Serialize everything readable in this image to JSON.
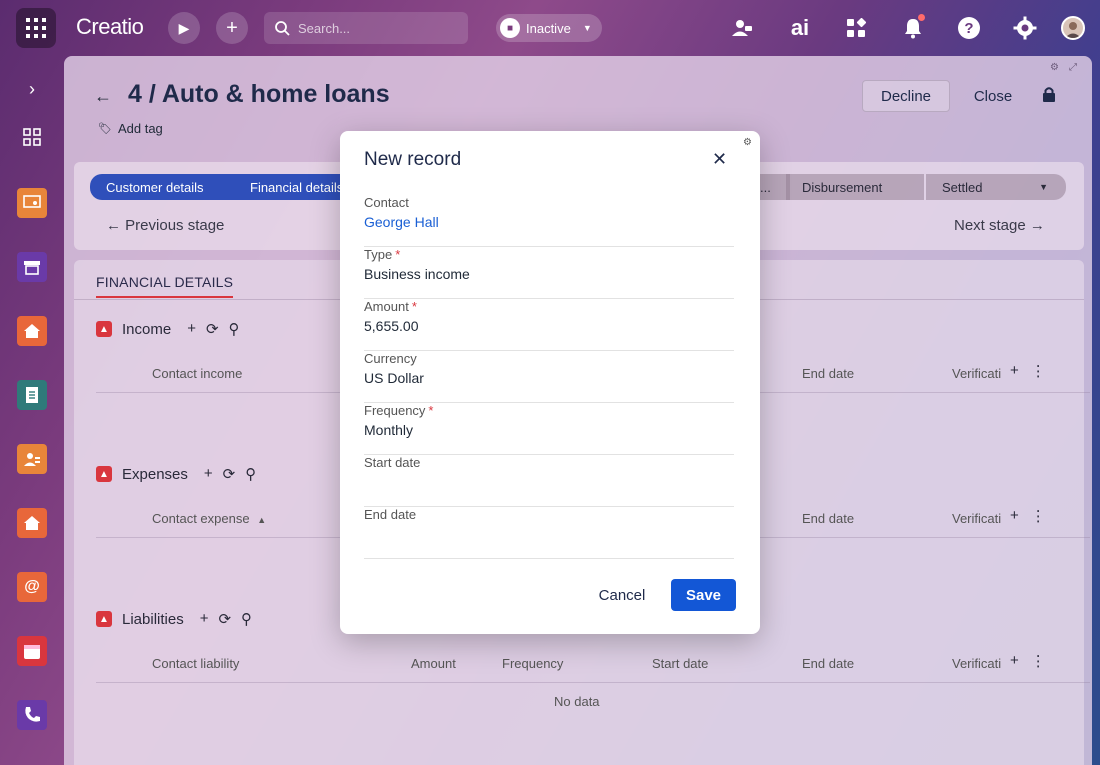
{
  "topbar": {
    "logo": "Creatio",
    "search_placeholder": "Search...",
    "status_label": "Inactive"
  },
  "record": {
    "title": "4 / Auto & home loans",
    "add_tag": "Add tag",
    "decline": "Decline",
    "close": "Close"
  },
  "stages": {
    "items": [
      "Customer details",
      "Financial details",
      "...",
      "Disbursement",
      "Settled"
    ],
    "prev": "Previous stage",
    "next": "Next stage"
  },
  "details": {
    "tab": "FINANCIAL DETAILS",
    "income": {
      "title": "Income",
      "columns": [
        "Contact income",
        "End date",
        "Verificati"
      ]
    },
    "expenses": {
      "title": "Expenses",
      "columns": [
        "Contact expense",
        "End date",
        "Verificati"
      ]
    },
    "liabilities": {
      "title": "Liabilities",
      "columns": [
        "Contact liability",
        "Amount",
        "Frequency",
        "Start date",
        "End date",
        "Verificati"
      ],
      "empty": "No data"
    }
  },
  "modal": {
    "title": "New record",
    "fields": [
      {
        "label": "Contact",
        "value": "George Hall",
        "required": false
      },
      {
        "label": "Type",
        "value": "Business income",
        "required": true
      },
      {
        "label": "Amount",
        "value": "5,655.00",
        "required": true
      },
      {
        "label": "Currency",
        "value": "US Dollar",
        "required": false
      },
      {
        "label": "Frequency",
        "value": "Monthly",
        "required": true
      },
      {
        "label": "Start date",
        "value": "",
        "required": false
      },
      {
        "label": "End date",
        "value": "",
        "required": false
      }
    ],
    "cancel": "Cancel",
    "save": "Save"
  },
  "colors": {
    "primary": "#1357d6",
    "stage_done": "#2f4fba",
    "accent_red": "#d9363e",
    "link": "#1a5fd4"
  }
}
